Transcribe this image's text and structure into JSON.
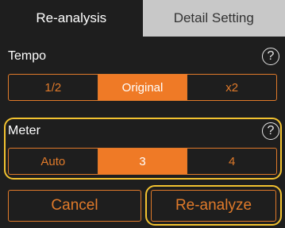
{
  "tabs": {
    "reanalysis": "Re-analysis",
    "detail_setting": "Detail Setting"
  },
  "tempo": {
    "label": "Tempo",
    "help": "?",
    "options": [
      "1/2",
      "Original",
      "x2"
    ],
    "selected": "Original"
  },
  "meter": {
    "label": "Meter",
    "help": "?",
    "options": [
      "Auto",
      "3",
      "4"
    ],
    "selected": "3"
  },
  "actions": {
    "cancel": "Cancel",
    "reanalyze": "Re-analyze"
  },
  "colors": {
    "accent": "#ef7a26",
    "highlight": "#f2c230",
    "background": "#1e1e1e",
    "inactive_tab": "#c8c8c8"
  }
}
